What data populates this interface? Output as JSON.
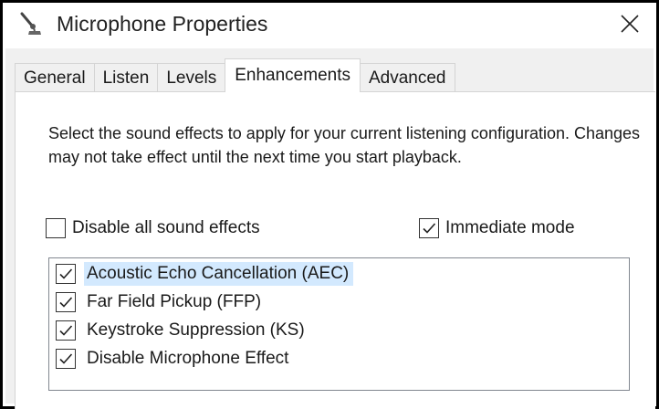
{
  "window": {
    "title": "Microphone Properties",
    "icon": "microphone-icon",
    "close_icon": "close-icon"
  },
  "tabs": [
    {
      "label": "General",
      "active": false
    },
    {
      "label": "Listen",
      "active": false
    },
    {
      "label": "Levels",
      "active": false
    },
    {
      "label": "Enhancements",
      "active": true
    },
    {
      "label": "Advanced",
      "active": false
    }
  ],
  "enhancements": {
    "description": "Select the sound effects to apply for your current listening configuration. Changes may not take effect until the next time you start playback.",
    "disable_all": {
      "label": "Disable all sound effects",
      "checked": false
    },
    "immediate_mode": {
      "label": "Immediate mode",
      "checked": true
    },
    "effects": [
      {
        "label": "Acoustic Echo Cancellation (AEC)",
        "checked": true,
        "selected": true
      },
      {
        "label": "Far Field Pickup (FFP)",
        "checked": true,
        "selected": false
      },
      {
        "label": "Keystroke Suppression (KS)",
        "checked": true,
        "selected": false
      },
      {
        "label": "Disable Microphone Effect",
        "checked": true,
        "selected": false
      }
    ]
  },
  "colors": {
    "selection": "#d3e9fe",
    "panel_bg": "#ffffff",
    "dialog_bg": "#f0f0f0"
  }
}
